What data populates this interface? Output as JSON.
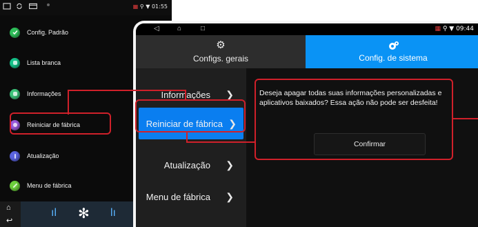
{
  "left_screen": {
    "status": {
      "time": "01:55"
    },
    "menu": [
      {
        "label": "Config. Padrão",
        "color": "#2fbf5a"
      },
      {
        "label": "Lista branca",
        "color": "#16c28a"
      },
      {
        "label": "Informações",
        "color": "#3cc47a"
      },
      {
        "label": "Reiniciar de fábrica",
        "color": "#9a5bdc"
      },
      {
        "label": "Atualização",
        "color": "#5a63e0"
      },
      {
        "label": "Menu de fábrica",
        "color": "#6ccf3c"
      }
    ]
  },
  "right_screen": {
    "status": {
      "time": "09:44"
    },
    "tabs": [
      {
        "label": "Configs. gerais",
        "icon": "gear-icon"
      },
      {
        "label": "Config. de sistema",
        "icon": "system-icon"
      }
    ],
    "side_menu": [
      {
        "label": "Informações"
      },
      {
        "label": "Reiniciar de fábrica"
      },
      {
        "label": "Atualização"
      },
      {
        "label": "Menu de fábrica"
      }
    ],
    "message": "Deseja apagar todas suas informações personalizadas e aplicativos baixados? Essa ação não pode ser desfeita!",
    "confirm_label": "Confirmar"
  },
  "colors": {
    "accent": "#0a93f5",
    "highlight": "#d0202a"
  }
}
